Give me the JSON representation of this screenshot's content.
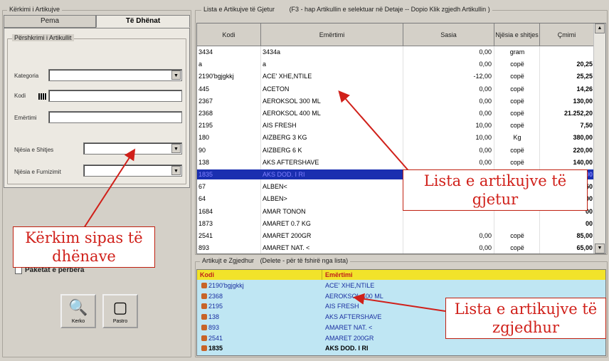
{
  "left": {
    "group_title": "Kërkimi i Artikujve",
    "tabs": [
      "Pema",
      "Të Dhënat"
    ],
    "search_group_title": "Përshkrimi i Artikullit",
    "fields": {
      "kategoria": "Kategoria",
      "kodi": "Kodi",
      "emertimi": "Emërtimi",
      "njesia_shitjes": "Njësia e Shitjes",
      "njesia_furnizimit": "Njësia e Furnizimit"
    },
    "checkbox_label": "Paketat e përbëra",
    "buttons": {
      "search": "Kerko",
      "clear": "Pastro"
    }
  },
  "found": {
    "title": "Lista e Artikujve të Gjetur",
    "hint": "(F3 - hap Artikullin e selektuar në Detaje  -- Dopio Klik zgjedh Artikullin )",
    "columns": [
      "Kodi",
      "Emërtimi",
      "Sasia",
      "Njësia e shitjes",
      "Çmimi"
    ],
    "rows": [
      [
        "3434",
        "3434a",
        "0,00",
        "gram",
        ""
      ],
      [
        "a",
        "a",
        "0,00",
        "copë",
        "20,25"
      ],
      [
        "2190'bgjgkkj",
        "ACE' XHE,NTILE",
        "-12,00",
        "copë",
        "25,25"
      ],
      [
        "445",
        "ACETON",
        "0,00",
        "copë",
        "14,26"
      ],
      [
        "2367",
        "AEROKSOL 300 ML",
        "0,00",
        "copë",
        "130,00"
      ],
      [
        "2368",
        "AEROKSOL 400 ML",
        "0,00",
        "copë",
        "21.252,20"
      ],
      [
        "2195",
        "AIS FRESH",
        "10,00",
        "copë",
        "7,50"
      ],
      [
        "180",
        "AIZBERG 3 KG",
        "10,00",
        "Kg",
        "380,00"
      ],
      [
        "90",
        "AIZBERG 6 K",
        "0,00",
        "copë",
        "220,00"
      ],
      [
        "138",
        "AKS AFTERSHAVE",
        "0,00",
        "copë",
        "140,00"
      ],
      [
        "1835",
        "AKS DOD. I RI",
        "",
        "",
        "00"
      ],
      [
        "67",
        "ALBEN<",
        "",
        "",
        "50"
      ],
      [
        "64",
        "ALBEN>",
        "",
        "",
        "00"
      ],
      [
        "1684",
        "AMAR TONON",
        "",
        "",
        "00"
      ],
      [
        "1873",
        "AMARET 0.7 KG",
        "",
        "",
        "00"
      ],
      [
        "2541",
        "AMARET 200GR",
        "0,00",
        "copë",
        "85,00"
      ],
      [
        "893",
        "AMARET NAT. <",
        "0,00",
        "copë",
        "65,00"
      ]
    ]
  },
  "chosen": {
    "title": "Artikujt e Zgjedhur",
    "hint": "(Delete - për të fshirë nga lista)",
    "columns": [
      "Kodi",
      "Emërtimi"
    ],
    "rows": [
      [
        "2190'bgjgkkj",
        "ACE' XHE,NTILE"
      ],
      [
        "2368",
        "AEROKSOL 400 ML"
      ],
      [
        "2195",
        "AIS FRESH"
      ],
      [
        "138",
        "AKS AFTERSHAVE"
      ],
      [
        "893",
        "AMARET NAT. <"
      ],
      [
        "2541",
        "AMARET 200GR"
      ],
      [
        "1835",
        "AKS DOD. I RI"
      ]
    ]
  },
  "callouts": {
    "search_by_data": "Kërkim sipas të dhënave",
    "found_list": "Lista e artikujve të gjetur",
    "chosen_list": "Lista e artikujve të zgjedhur"
  },
  "colors": {
    "selected_row": "#1a2fb0",
    "chosen_bg": "#bfe6f3",
    "chosen_header": "#f2e32a",
    "callout_red": "#d0201a"
  }
}
